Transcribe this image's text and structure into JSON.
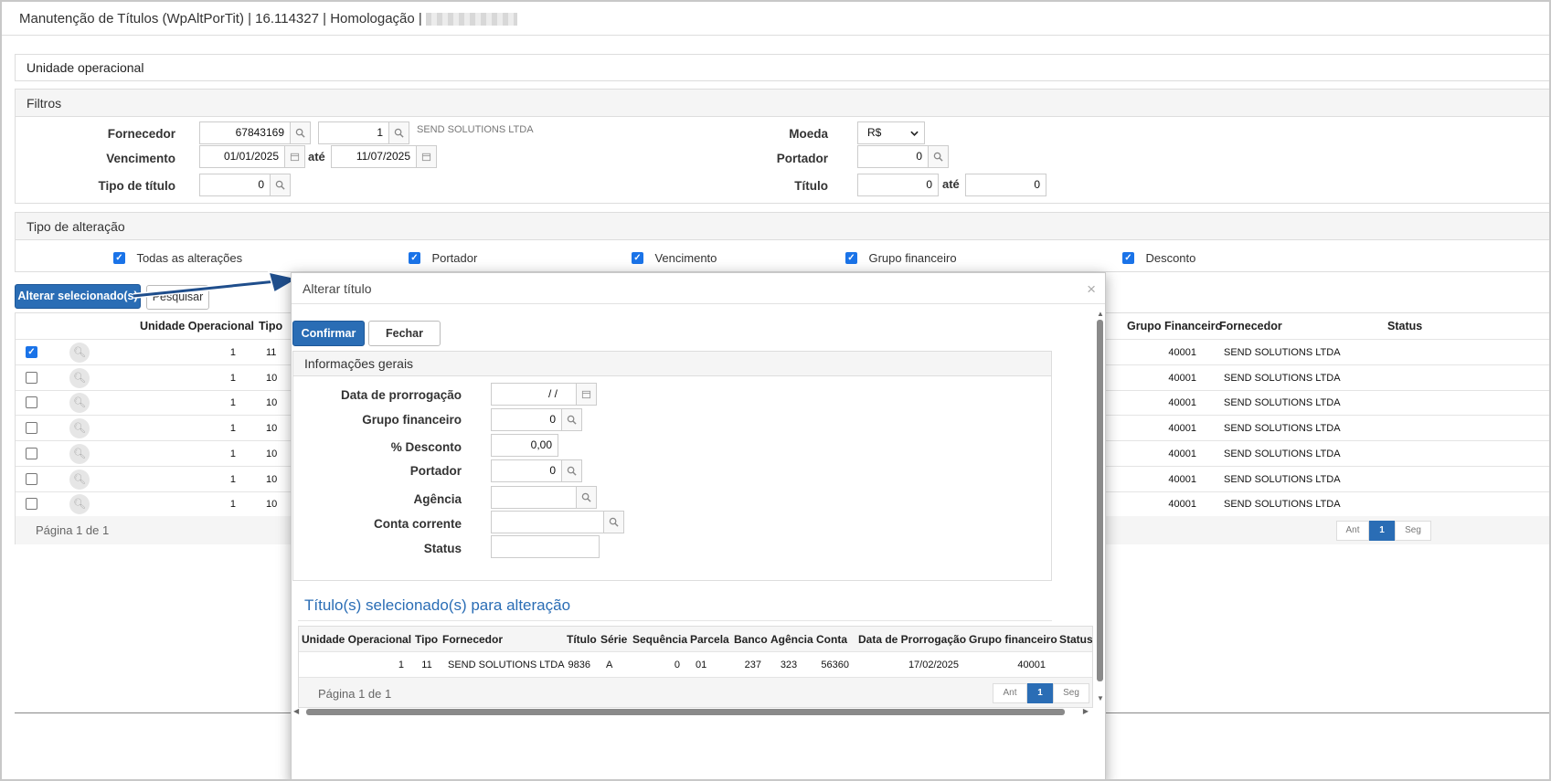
{
  "window": {
    "title": "Manutenção de Títulos (WpAltPorTit) | 16.114327 | Homologação |"
  },
  "unidade": {
    "title": "Unidade operacional"
  },
  "filtros": {
    "title": "Filtros",
    "fornecedor_label": "Fornecedor",
    "fornecedor_code": "67843169",
    "fornecedor_seq": "1",
    "fornecedor_name": "SEND SOLUTIONS LTDA",
    "vencimento_label": "Vencimento",
    "vencimento_from": "01/01/2025",
    "ate": "até",
    "vencimento_to": "11/07/2025",
    "tipo_label": "Tipo de título",
    "tipo_value": "0",
    "moeda_label": "Moeda",
    "moeda_value": "R$",
    "portador_label": "Portador",
    "portador_value": "0",
    "titulo_label": "Título",
    "titulo_from": "0",
    "titulo_to": "0"
  },
  "tipo_alteracao": {
    "title": "Tipo de alteração",
    "options": [
      {
        "label": "Todas as alterações",
        "checked": true
      },
      {
        "label": "Portador",
        "checked": true
      },
      {
        "label": "Vencimento",
        "checked": true
      },
      {
        "label": "Grupo financeiro",
        "checked": true
      },
      {
        "label": "Desconto",
        "checked": true
      }
    ]
  },
  "actions": {
    "alterar_label": "Alterar selecionado(s)",
    "pesquisar_label": "Pesquisar"
  },
  "grid": {
    "headers": {
      "unidade": "Unidade Operacional",
      "tipo": "Tipo",
      "grupo": "Grupo Financeiro",
      "fornecedor": "Fornecedor",
      "status": "Status"
    },
    "rows": [
      {
        "checked": true,
        "unidade": "1",
        "tipo": "11",
        "grupo": "40001",
        "fornecedor": "SEND SOLUTIONS LTDA"
      },
      {
        "checked": false,
        "unidade": "1",
        "tipo": "10",
        "grupo": "40001",
        "fornecedor": "SEND SOLUTIONS LTDA"
      },
      {
        "checked": false,
        "unidade": "1",
        "tipo": "10",
        "grupo": "40001",
        "fornecedor": "SEND SOLUTIONS LTDA"
      },
      {
        "checked": false,
        "unidade": "1",
        "tipo": "10",
        "grupo": "40001",
        "fornecedor": "SEND SOLUTIONS LTDA"
      },
      {
        "checked": false,
        "unidade": "1",
        "tipo": "10",
        "grupo": "40001",
        "fornecedor": "SEND SOLUTIONS LTDA"
      },
      {
        "checked": false,
        "unidade": "1",
        "tipo": "10",
        "grupo": "40001",
        "fornecedor": "SEND SOLUTIONS LTDA"
      },
      {
        "checked": false,
        "unidade": "1",
        "tipo": "10",
        "grupo": "40001",
        "fornecedor": "SEND SOLUTIONS LTDA"
      }
    ],
    "pagination": {
      "label": "Página 1 de 1",
      "prev": "Ant",
      "current": "1",
      "next": "Seg"
    }
  },
  "modal": {
    "title": "Alterar título",
    "close": "×",
    "confirm_label": "Confirmar",
    "close_label": "Fechar",
    "info": {
      "title": "Informações gerais",
      "data_label": "Data de prorrogação",
      "data_value": "/ /",
      "grupo_label": "Grupo financeiro",
      "grupo_value": "0",
      "desconto_label": "% Desconto",
      "desconto_value": "0,00",
      "portador_label": "Portador",
      "portador_value": "0",
      "agencia_label": "Agência",
      "agencia_value": "",
      "conta_label": "Conta corrente",
      "conta_value": "",
      "status_label": "Status",
      "status_value": ""
    },
    "selected": {
      "title": "Título(s) selecionado(s) para alteração",
      "headers": [
        "Unidade Operacional",
        "Tipo",
        "Fornecedor",
        "Título",
        "Série",
        "Sequência",
        "Parcela",
        "Banco",
        "Agência",
        "Conta",
        "Data de Prorrogação",
        "Grupo financeiro",
        "Status"
      ],
      "row": [
        "1",
        "11",
        "SEND SOLUTIONS LTDA",
        "9836",
        "A",
        "0",
        "01",
        "237",
        "323",
        "56360",
        "17/02/2025",
        "40001",
        ""
      ],
      "pagination": {
        "label": "Página 1 de 1",
        "prev": "Ant",
        "current": "1",
        "next": "Seg"
      }
    }
  },
  "colors": {
    "primary": "#2a6db5",
    "checkbox": "#1a73e8",
    "heading_link": "#2a6db5",
    "arrow": "#1f4e8c"
  }
}
